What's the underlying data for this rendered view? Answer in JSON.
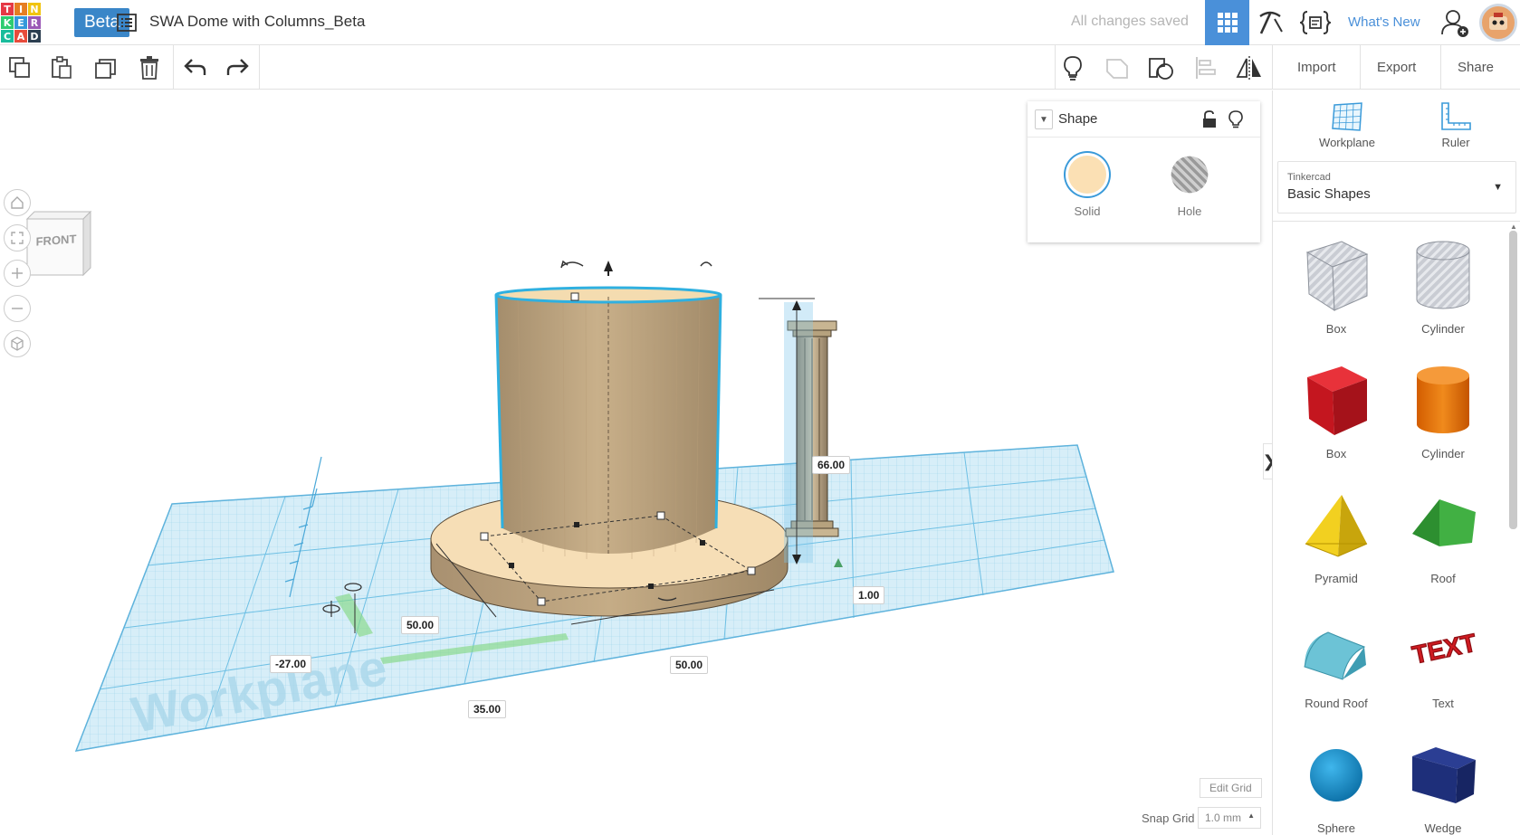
{
  "app": {
    "logo_letters": [
      "T",
      "I",
      "N",
      "K",
      "E",
      "R",
      "C",
      "A",
      "D"
    ],
    "logo_colors": [
      "#e63946",
      "#e67e22",
      "#f1c40f",
      "#2ecc71",
      "#3498db",
      "#9b59b6",
      "#1abc9c",
      "#e74c3c",
      "#2c3e50"
    ],
    "beta_label": "Beta",
    "design_title": "SWA Dome with Columns_Beta",
    "save_status": "All changes saved",
    "whats_new": "What's New",
    "accent": "#4a90d9"
  },
  "toolbar": {
    "import_label": "Import",
    "export_label": "Export",
    "share_label": "Share"
  },
  "viewport": {
    "view_cube_face": "FRONT",
    "workplane_text": "Workplane",
    "dimensions": {
      "height": "66.00",
      "elevation": "1.00",
      "width": "50.00",
      "depth": "50.00",
      "pos_x": "-27.00",
      "pos_y": "35.00"
    },
    "edit_grid_label": "Edit Grid",
    "snap_grid_label": "Snap Grid",
    "snap_grid_value": "1.0 mm"
  },
  "shape_panel": {
    "title": "Shape",
    "solid_label": "Solid",
    "hole_label": "Hole",
    "solid_color": "#fbe0b4"
  },
  "sidepanel": {
    "workplane_label": "Workplane",
    "ruler_label": "Ruler",
    "library_source": "Tinkercad",
    "library_name": "Basic Shapes",
    "shapes": [
      {
        "label": "Box",
        "kind": "box-hole"
      },
      {
        "label": "Cylinder",
        "kind": "cylinder-hole"
      },
      {
        "label": "Box",
        "kind": "box"
      },
      {
        "label": "Cylinder",
        "kind": "cylinder"
      },
      {
        "label": "Pyramid",
        "kind": "pyramid"
      },
      {
        "label": "Roof",
        "kind": "roof"
      },
      {
        "label": "Round Roof",
        "kind": "round-roof"
      },
      {
        "label": "Text",
        "kind": "text"
      },
      {
        "label": "Sphere",
        "kind": "sphere"
      },
      {
        "label": "Wedge",
        "kind": "wedge"
      }
    ],
    "text_shape_word": "TEXT"
  }
}
